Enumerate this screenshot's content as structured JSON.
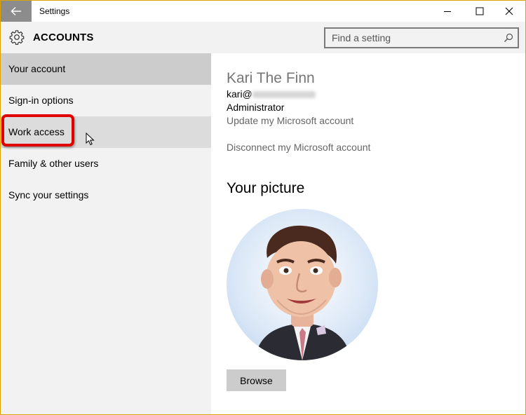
{
  "window": {
    "title": "Settings"
  },
  "header": {
    "section_title": "ACCOUNTS",
    "search_placeholder": "Find a setting"
  },
  "sidebar": {
    "items": [
      {
        "label": "Your account",
        "state": "selected"
      },
      {
        "label": "Sign-in options",
        "state": "normal"
      },
      {
        "label": "Work access",
        "state": "hover"
      },
      {
        "label": "Family & other users",
        "state": "normal"
      },
      {
        "label": "Sync your settings",
        "state": "normal"
      }
    ]
  },
  "account": {
    "name": "Kari The Finn",
    "email_prefix": "kari@",
    "role": "Administrator",
    "update_link": "Update my Microsoft account",
    "disconnect_link": "Disconnect my Microsoft account"
  },
  "picture": {
    "heading": "Your picture",
    "browse_label": "Browse"
  },
  "colors": {
    "accent_border": "#d9a400",
    "highlight_red": "#e00000",
    "selected_bg": "#cccccc"
  }
}
